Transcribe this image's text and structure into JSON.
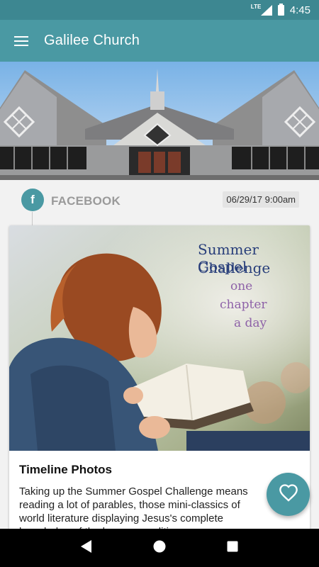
{
  "status_bar": {
    "network": "LTE",
    "time": "4:45"
  },
  "app_bar": {
    "title": "Galilee Church",
    "menu_icon": "hamburger-menu-icon"
  },
  "banner": {
    "icon": "church-building-image"
  },
  "feed": {
    "source_label": "FACEBOOK",
    "source_icon": "facebook-icon",
    "timestamp": "06/29/17 9:00am",
    "card": {
      "image_text": {
        "line1": "Summer Gospel",
        "line2": "Challenge",
        "line3": "one",
        "line4": "chapter",
        "line5": "a day"
      },
      "title": "Timeline Photos",
      "body": "Taking up the Summer Gospel Challenge means reading a lot of parables, those mini-classics of world literature displaying Jesus's complete knowledge of the human condition..."
    }
  },
  "fab": {
    "icon": "heart-icon"
  },
  "colors": {
    "accent": "#4a99a3",
    "status_bar": "#3d8791"
  }
}
